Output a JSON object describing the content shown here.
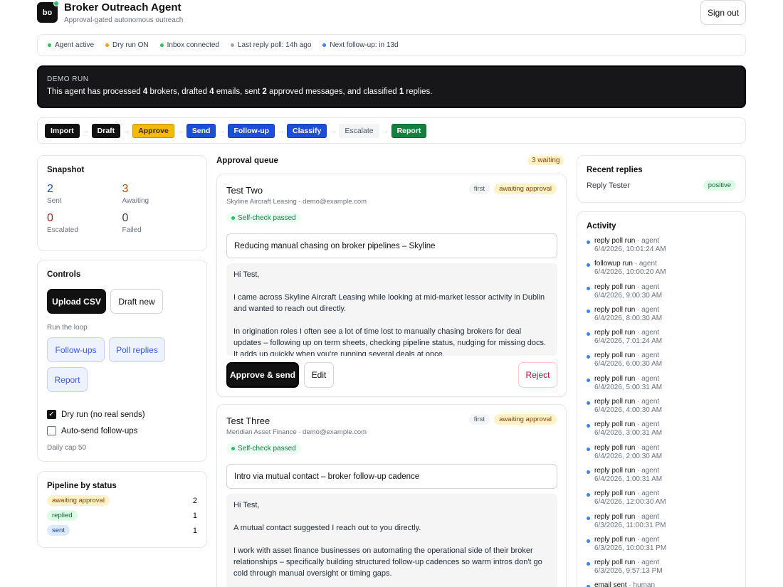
{
  "header": {
    "logo_text": "bo",
    "title": "Broker Outreach Agent",
    "subtitle": "Approval-gated autonomous outreach",
    "signout_label": "Sign out"
  },
  "status_bar": [
    {
      "label": "Agent active",
      "color": "#22c55e"
    },
    {
      "label": "Dry run ON",
      "color": "#f59e0b"
    },
    {
      "label": "Inbox connected",
      "color": "#22c55e"
    },
    {
      "label": "Last reply poll: 14h ago",
      "color": "#9ca3af"
    },
    {
      "label": "Next follow-up: in 13d",
      "color": "#3b82f6"
    }
  ],
  "banner": {
    "label": "DEMO RUN",
    "text_prefix": "This agent has processed ",
    "brokers": "4",
    "text_mid1": " brokers, drafted ",
    "emails": "4",
    "text_mid2": " emails, sent ",
    "sent": "2",
    "text_mid3": " approved messages, and classified ",
    "classified": "1",
    "text_suffix": " replies."
  },
  "steps": [
    {
      "label": "Import",
      "bg": "#111111",
      "fg": "#ffffff"
    },
    {
      "label": "Draft",
      "bg": "#111111",
      "fg": "#ffffff"
    },
    {
      "label": "Approve",
      "bg": "#f5b90a",
      "fg": "#3a2a00"
    },
    {
      "label": "Send",
      "bg": "#1d4ed8",
      "fg": "#ffffff"
    },
    {
      "label": "Follow-up",
      "bg": "#1d4ed8",
      "fg": "#ffffff"
    },
    {
      "label": "Classify",
      "bg": "#1d4ed8",
      "fg": "#ffffff"
    },
    {
      "label": "Escalate",
      "bg": "#f3f4f6",
      "fg": "#4b5563"
    },
    {
      "label": "Report",
      "bg": "#15803d",
      "fg": "#ffffff"
    }
  ],
  "snapshot": {
    "title": "Snapshot",
    "items": [
      {
        "value": "2",
        "label": "Sent",
        "color": "#1d4ed8"
      },
      {
        "value": "3",
        "label": "Awaiting",
        "color": "#b45309"
      },
      {
        "value": "0",
        "label": "Escalated",
        "color": "#b91c1c"
      },
      {
        "value": "0",
        "label": "Failed",
        "color": "#374151"
      }
    ]
  },
  "controls": {
    "title": "Controls",
    "upload_csv": "Upload CSV",
    "draft_new": "Draft new",
    "run_loop_label": "Run the loop",
    "followups": "Follow-ups",
    "poll_replies": "Poll replies",
    "report": "Report",
    "dry_run_label": "Dry run (no real sends)",
    "dry_run_checked": true,
    "auto_send_label": "Auto-send follow-ups",
    "auto_send_checked": false,
    "daily_cap": "Daily cap 50"
  },
  "pipeline": {
    "title": "Pipeline by status",
    "rows": [
      {
        "status": "awaiting approval",
        "count": "2",
        "bg": "#fef3c7",
        "fg": "#92400e"
      },
      {
        "status": "replied",
        "count": "1",
        "bg": "#dcfce7",
        "fg": "#166534"
      },
      {
        "status": "sent",
        "count": "1",
        "bg": "#dbeafe",
        "fg": "#1e40af"
      }
    ]
  },
  "queue": {
    "title": "Approval queue",
    "waiting": "3 waiting",
    "emails": [
      {
        "name": "Test Two",
        "company_line": "Skyline Aircraft Leasing · demo@example.com",
        "tag_stage": "first",
        "tag_status": "awaiting approval",
        "self_check": "Self-check passed",
        "subject": "Reducing manual chasing on broker pipelines – Skyline",
        "body": [
          "Hi Test,",
          "I came across Skyline Aircraft Leasing while looking at mid-market lessor activity in Dublin and wanted to reach out directly.",
          "In origination roles I often see a lot of time lost to manually chasing brokers for deal updates – following up on term sheets, checking pipeline status, nudging for missing docs. It adds up quickly when you're running several deals at once."
        ],
        "approve_label": "Approve & send",
        "edit_label": "Edit",
        "reject_label": "Reject"
      },
      {
        "name": "Test Three",
        "company_line": "Meridian Asset Finance · demo@example.com",
        "tag_stage": "first",
        "tag_status": "awaiting approval",
        "self_check": "Self-check passed",
        "subject": "Intro via mutual contact – broker follow-up cadence",
        "body": [
          "Hi Test,",
          "A mutual contact suggested I reach out to you directly.",
          "I work with asset finance businesses on automating the operational side of their broker relationships – specifically building structured follow-up cadences so warm intros don't go cold through manual oversight or timing gaps."
        ]
      }
    ]
  },
  "recent_replies": {
    "title": "Recent replies",
    "items": [
      {
        "name": "Reply Tester",
        "sentiment": "positive"
      }
    ]
  },
  "activity": {
    "title": "Activity",
    "items": [
      {
        "event": "reply poll run",
        "who": "agent",
        "time": "6/4/2026, 10:01:24 AM"
      },
      {
        "event": "followup run",
        "who": "agent",
        "time": "6/4/2026, 10:00:20 AM"
      },
      {
        "event": "reply poll run",
        "who": "agent",
        "time": "6/4/2026, 9:00:30 AM"
      },
      {
        "event": "reply poll run",
        "who": "agent",
        "time": "6/4/2026, 8:00:30 AM"
      },
      {
        "event": "reply poll run",
        "who": "agent",
        "time": "6/4/2026, 7:01:24 AM"
      },
      {
        "event": "reply poll run",
        "who": "agent",
        "time": "6/4/2026, 6:00:30 AM"
      },
      {
        "event": "reply poll run",
        "who": "agent",
        "time": "6/4/2026, 5:00:31 AM"
      },
      {
        "event": "reply poll run",
        "who": "agent",
        "time": "6/4/2026, 4:00:30 AM"
      },
      {
        "event": "reply poll run",
        "who": "agent",
        "time": "6/4/2026, 3:00:31 AM"
      },
      {
        "event": "reply poll run",
        "who": "agent",
        "time": "6/4/2026, 2:00:30 AM"
      },
      {
        "event": "reply poll run",
        "who": "agent",
        "time": "6/4/2026, 1:00:31 AM"
      },
      {
        "event": "reply poll run",
        "who": "agent",
        "time": "6/4/2026, 12:00:30 AM"
      },
      {
        "event": "reply poll run",
        "who": "agent",
        "time": "6/3/2026, 11:00:31 PM"
      },
      {
        "event": "reply poll run",
        "who": "agent",
        "time": "6/3/2026, 10:00:31 PM"
      },
      {
        "event": "reply poll run",
        "who": "agent",
        "time": "6/3/2026, 9:57:13 PM"
      },
      {
        "event": "email sent",
        "who": "human",
        "time": ""
      }
    ]
  }
}
